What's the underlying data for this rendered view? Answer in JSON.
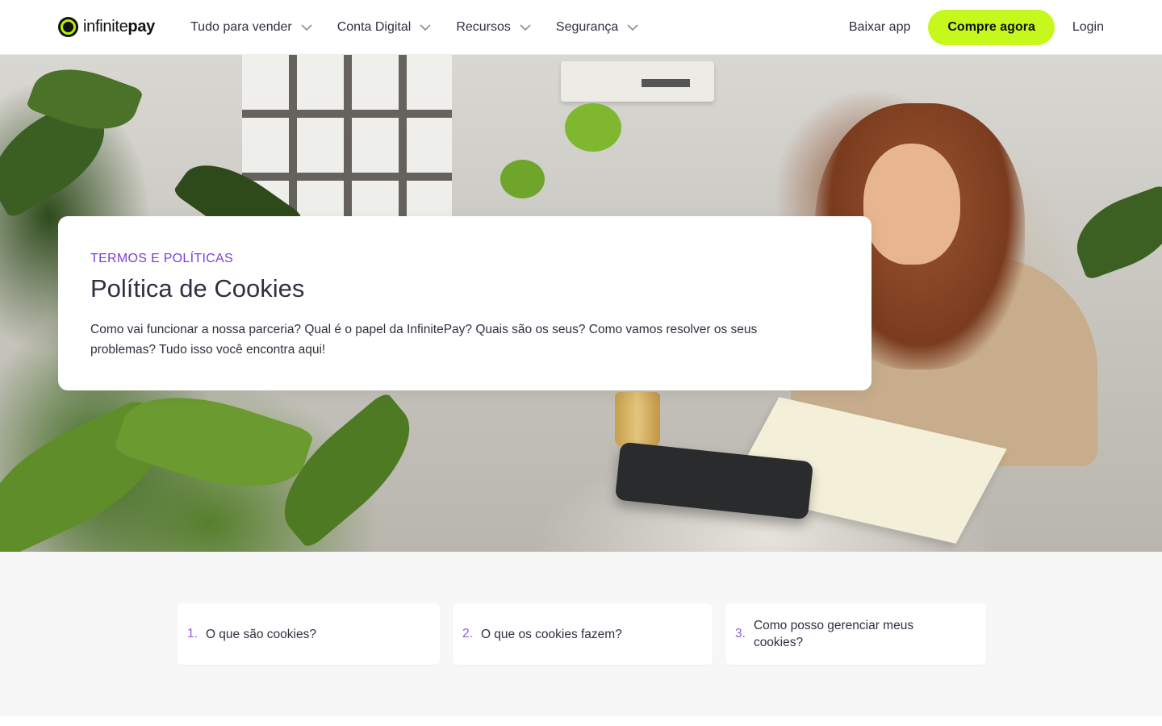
{
  "header": {
    "logo": {
      "text_light": "infinite",
      "text_bold": "pay"
    },
    "nav": [
      {
        "label": "Tudo para vender"
      },
      {
        "label": "Conta Digital"
      },
      {
        "label": "Recursos"
      },
      {
        "label": "Segurança"
      }
    ],
    "download_label": "Baixar app",
    "buy_label": "Compre agora",
    "login_label": "Login"
  },
  "hero": {
    "eyebrow": "TERMOS E POLÍTICAS",
    "title": "Política de Cookies",
    "description": "Como vai funcionar a nossa parceria? Qual é o papel da InfinitePay? Quais são os seus? Como vamos resolver os seus problemas? Tudo isso você encontra aqui!"
  },
  "toc": [
    {
      "num": "1.",
      "label": "O que são cookies?"
    },
    {
      "num": "2.",
      "label": "O que os cookies fazem?"
    },
    {
      "num": "3.",
      "label": "Como posso gerenciar meus cookies?"
    }
  ],
  "colors": {
    "accent_purple": "#7c3fd6",
    "cta_green": "#c6f81e",
    "text_dark": "#2f3140"
  },
  "icons": [
    "infinitepay-logo-icon",
    "chevron-down-icon"
  ]
}
